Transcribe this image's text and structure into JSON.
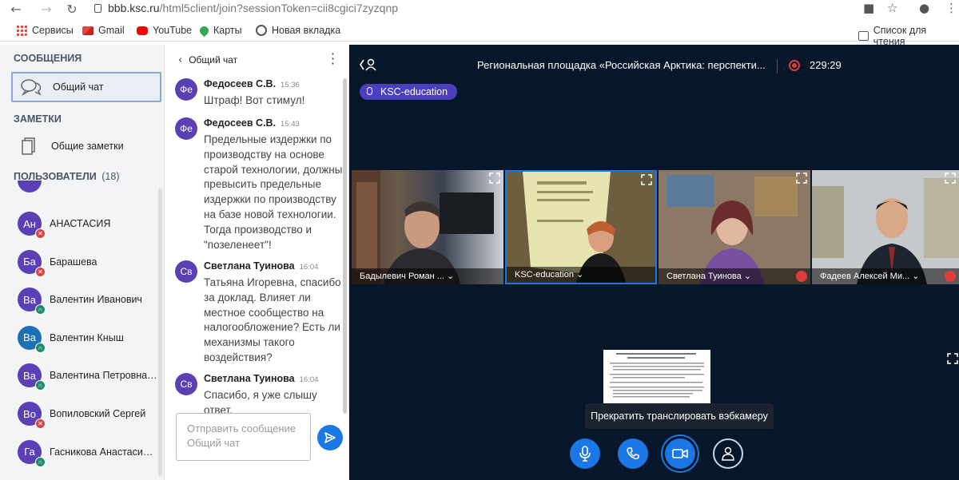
{
  "browser": {
    "url_host": "bbb.ksc.ru",
    "url_path": "/html5client/join?sessionToken=cii8cgici7zyzqnp",
    "bookmarks": [
      "Сервисы",
      "Gmail",
      "YouTube",
      "Карты",
      "Новая вкладка"
    ],
    "reading_list": "Список для чтения"
  },
  "sidebar": {
    "messages_header": "СООБЩЕНИЯ",
    "public_chat": "Общий чат",
    "notes_header": "ЗАМЕТКИ",
    "shared_notes": "Общие заметки",
    "users_header": "ПОЛЬЗОВАТЕЛИ",
    "users_count": "(18)",
    "users": [
      {
        "initials": "Ан",
        "name": "АНАСТАСИЯ",
        "color": "#5b3fb5",
        "badge": "muted"
      },
      {
        "initials": "Ба",
        "name": "Барашева",
        "color": "#5b3fb5",
        "badge": "muted"
      },
      {
        "initials": "Ва",
        "name": "Валентин Иванович",
        "color": "#5b3fb5",
        "badge": "headset"
      },
      {
        "initials": "Ва",
        "name": "Валентин Кныш",
        "color": "#1f6fb5",
        "badge": "headset"
      },
      {
        "initials": "Ва",
        "name": "Валентина Петровна П.",
        "color": "#5b3fb5",
        "badge": "headset"
      },
      {
        "initials": "Во",
        "name": "Вопиловский Сергей",
        "color": "#5b3fb5",
        "badge": "muted"
      },
      {
        "initials": "Га",
        "name": "Гасникова Анастасия ...",
        "color": "#5b3fb5",
        "badge": "headset"
      }
    ]
  },
  "chat": {
    "title": "Общий чат",
    "messages": [
      {
        "initials": "Фе",
        "author": "Федосеев С.В.",
        "time": "15:36",
        "text": "Штраф! Вот стимул!",
        "color": "#5b3fb5"
      },
      {
        "initials": "Фе",
        "author": "Федосеев С.В.",
        "time": "15:43",
        "text": "Предельные издержки по производству на основе старой технологии, должны превысить предельные издержки по производству на базе новой технологии. Тогда производство и \"позеленеет\"!",
        "color": "#5b3fb5"
      },
      {
        "initials": "Св",
        "author": "Светлана Туинова",
        "time": "16:04",
        "text": "Татьяна Игоревна, спасибо за доклад. Влияет ли местное сообщество на налогообложение? Есть ли механизмы такого воздействия?",
        "color": "#5b3fb5"
      },
      {
        "initials": "Св",
        "author": "Светлана Туинова",
        "time": "16:04",
        "text": "Спасибо, я уже слышу ответ.",
        "color": "#5b3fb5"
      }
    ],
    "input_placeholder": "Отправить сообщение Общий чат"
  },
  "main": {
    "title": "Региональная площадка «Российская Арктика: перспекти...",
    "rec_time": "229:29",
    "talker": "KSC-education",
    "tiles": [
      {
        "name": "Бадылевич Роман ...",
        "muted": false
      },
      {
        "name": "KSC-education",
        "muted": false
      },
      {
        "name": "Светлана Туинова",
        "muted": true
      },
      {
        "name": "Фадеев Алексей Ми...",
        "muted": true
      }
    ],
    "tooltip": "Прекратить транслировать вэбкамеру",
    "controls": [
      "microphone-button",
      "phone-button",
      "webcam-button",
      "presenter-button"
    ]
  }
}
